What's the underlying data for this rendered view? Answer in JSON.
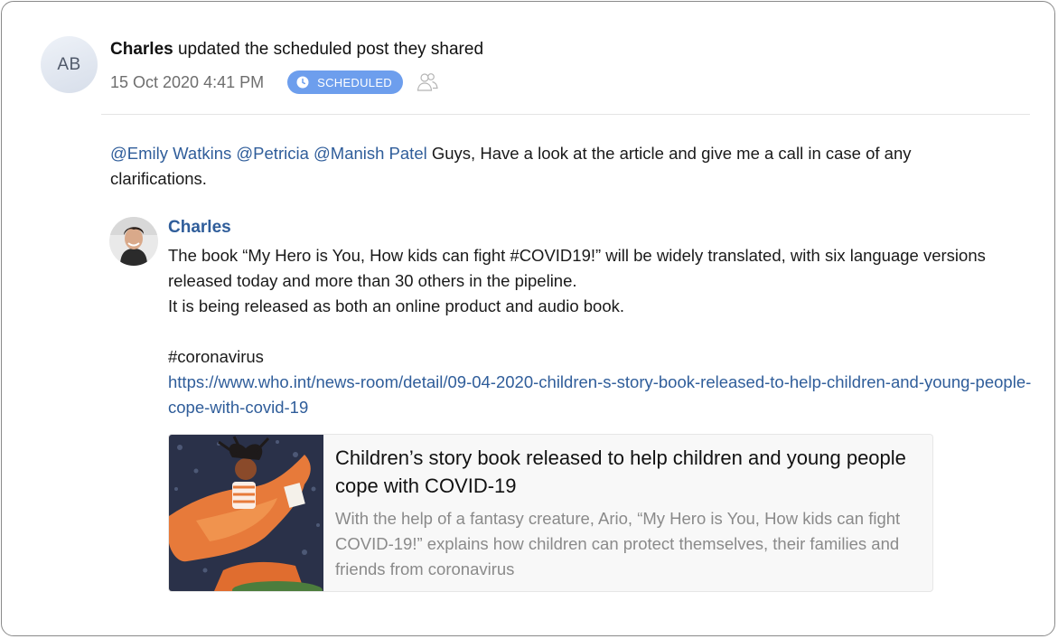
{
  "author": {
    "initials": "AB",
    "name": "Charles",
    "action": "updated the scheduled post they shared"
  },
  "meta": {
    "timestamp": "15 Oct 2020 4:41 PM",
    "status_badge": "SCHEDULED",
    "status_icon": "clock-icon",
    "audience_icon": "people-icon"
  },
  "message": {
    "mentions": [
      "@Emily Watkins",
      "@Petricia",
      "@Manish Patel"
    ],
    "text": "Guys, Have a look at the article and give me a call in case of any clarifications."
  },
  "shared_post": {
    "author_name": "Charles",
    "line1": "The book “My Hero is You, How kids can fight #COVID19!” will be widely translated, with six language versions released today and more than 30 others in the pipeline.",
    "line2": "It is being released as both an online product and audio book.",
    "hashtag": "#coronavirus",
    "link": "https://www.who.int/news-room/detail/09-04-2020-children-s-story-book-released-to-help-children-and-young-people-cope-with-covid-19"
  },
  "link_preview": {
    "title": "Children’s story book released to help children and young people cope with COVID-19",
    "description": "With the help of a fantasy creature, Ario, “My Hero is You, How kids can fight COVID-19!” explains how children can protect themselves, their families and friends from coronavirus"
  },
  "colors": {
    "accent_link": "#2f5d9a",
    "badge_bg": "#6d9eed"
  }
}
